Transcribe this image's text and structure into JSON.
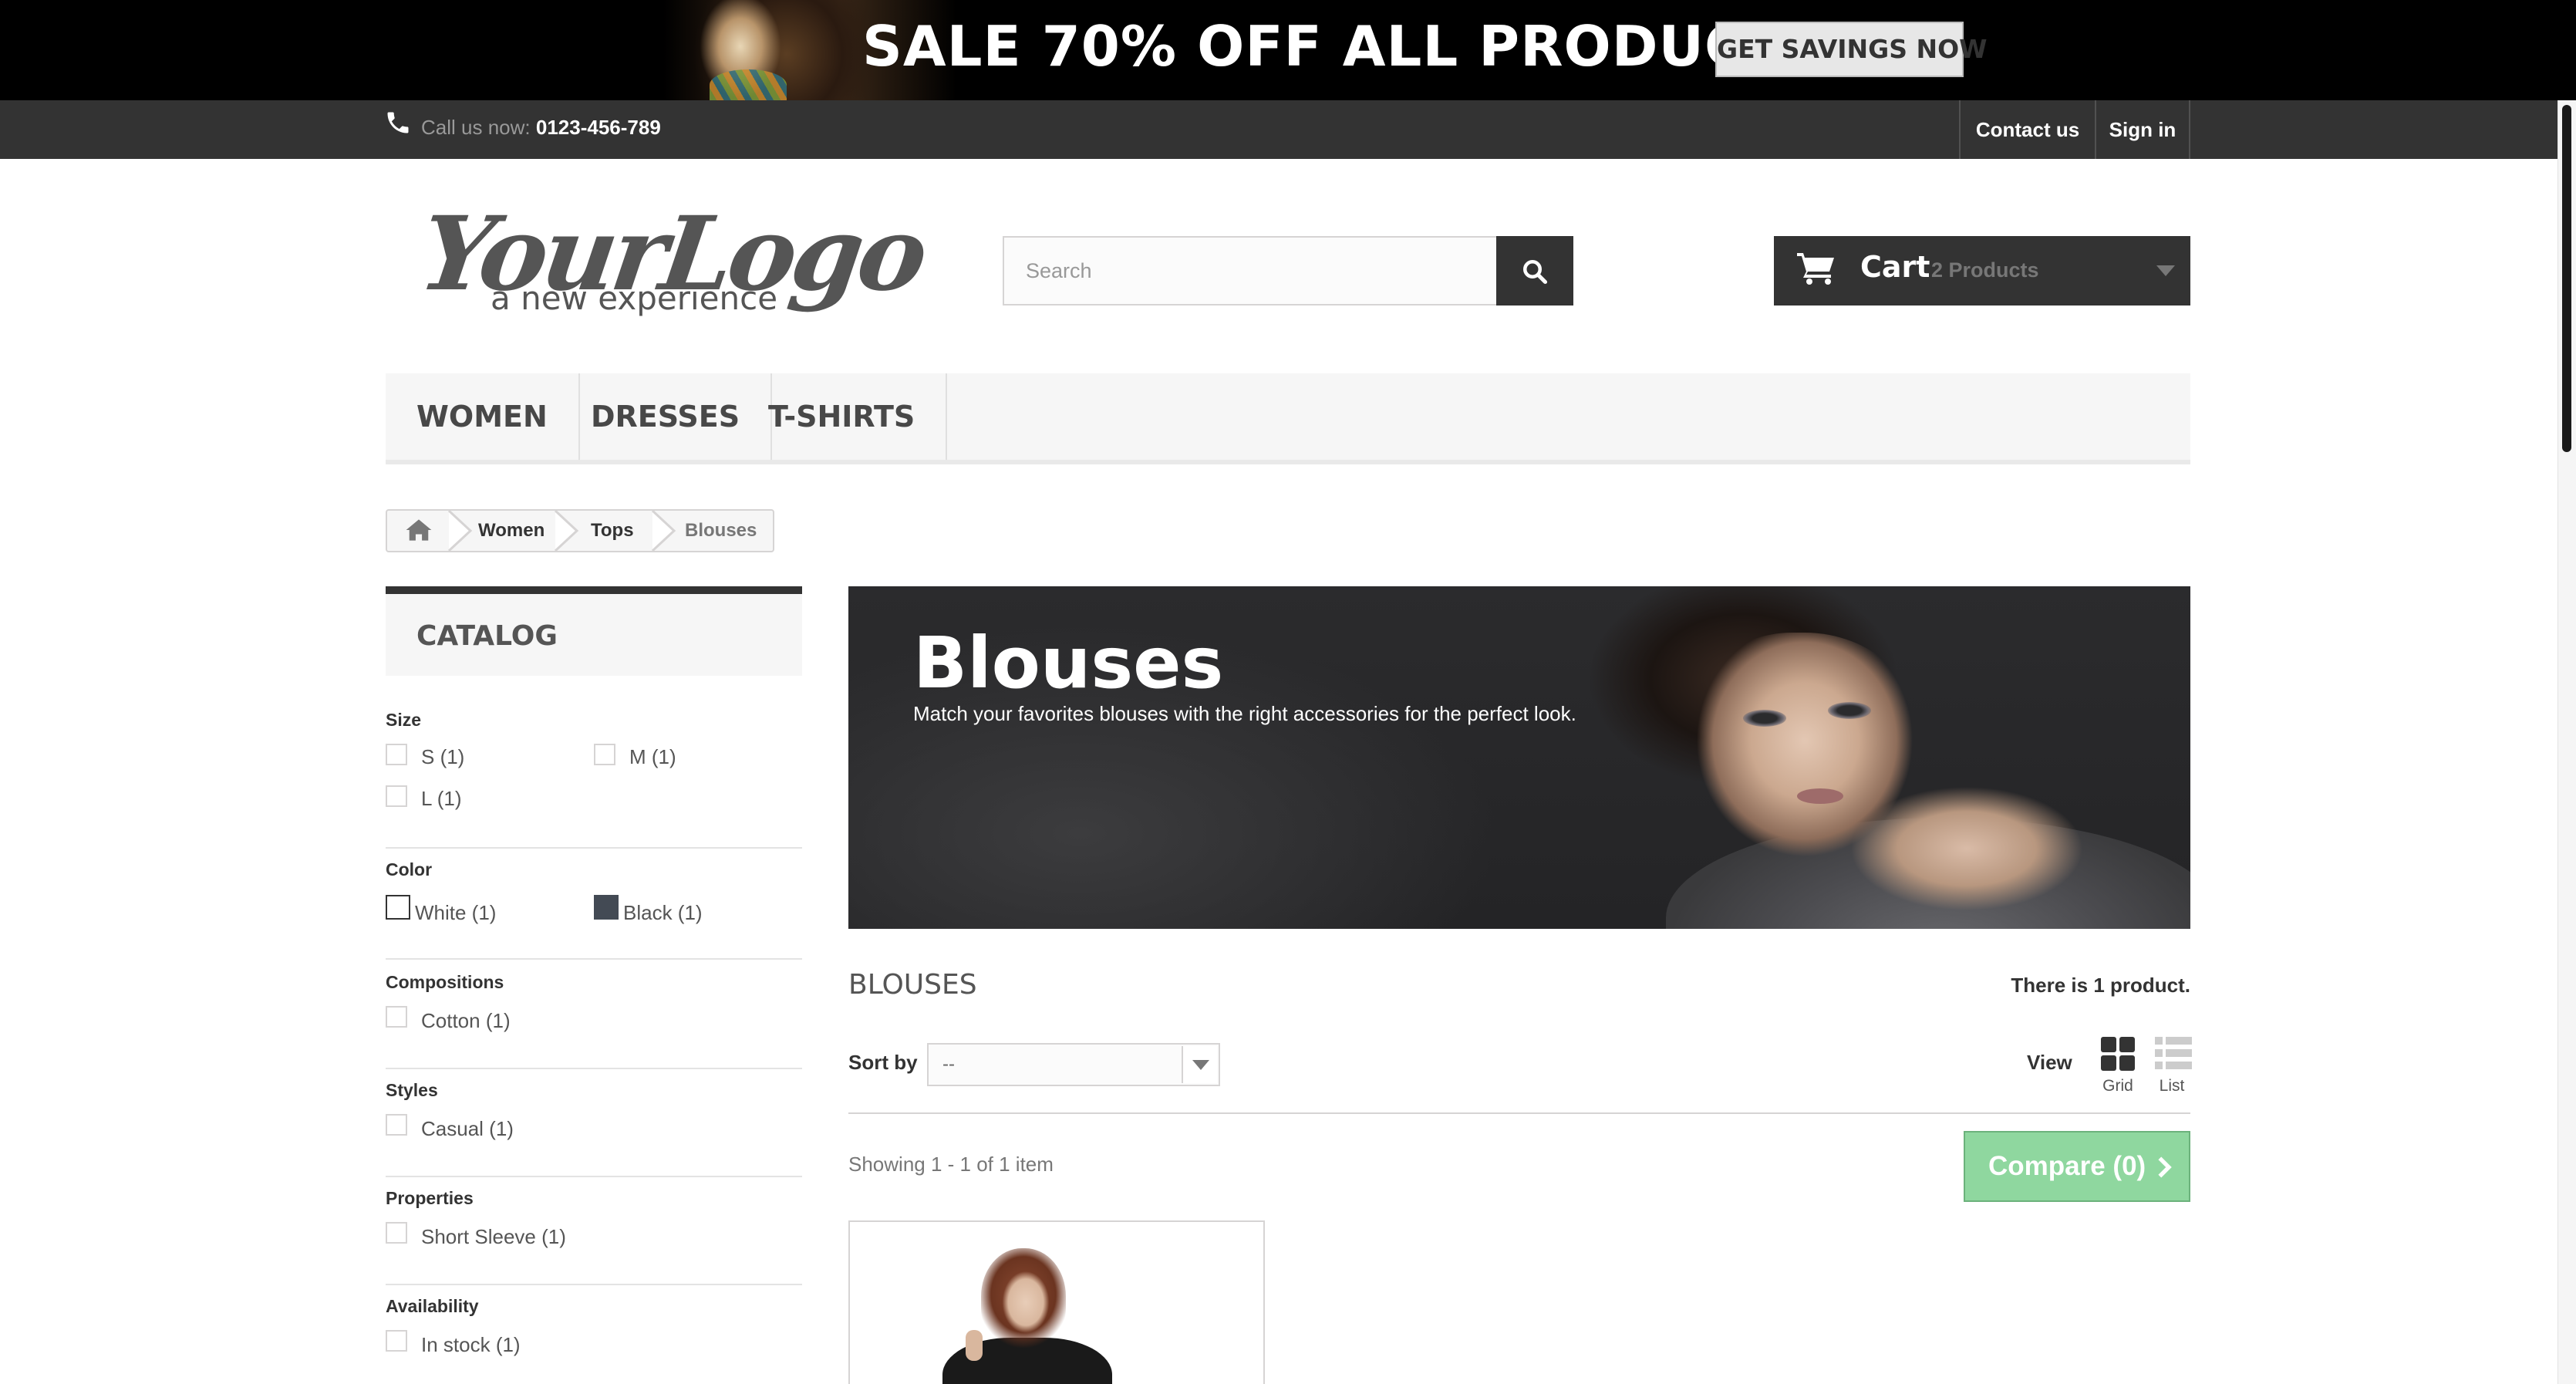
{
  "promo": {
    "headline": "SALE 70% OFF ALL PRODUCTS",
    "button": "GET SAVINGS NOW"
  },
  "topnav": {
    "call_label": "Call us now:",
    "phone": "0123-456-789",
    "contact": "Contact us",
    "signin": "Sign in"
  },
  "logo": {
    "main": "YourLogo",
    "tagline": "a new experience"
  },
  "search": {
    "placeholder": "Search"
  },
  "cart": {
    "label": "Cart",
    "count": "2 Products"
  },
  "menu": {
    "items": [
      "WOMEN",
      "DRESSES",
      "T-SHIRTS"
    ]
  },
  "breadcrumb": {
    "items": [
      "Women",
      "Tops",
      "Blouses"
    ]
  },
  "sidebar": {
    "title": "CATALOG",
    "filters": {
      "size": {
        "title": "Size",
        "options": [
          "S (1)",
          "M (1)",
          "L (1)"
        ]
      },
      "color": {
        "title": "Color",
        "options": [
          {
            "label": "White (1)",
            "color": "#ffffff"
          },
          {
            "label": "Black (1)",
            "color": "#434a54"
          }
        ]
      },
      "compositions": {
        "title": "Compositions",
        "options": [
          "Cotton (1)"
        ]
      },
      "styles": {
        "title": "Styles",
        "options": [
          "Casual (1)"
        ]
      },
      "properties": {
        "title": "Properties",
        "options": [
          "Short Sleeve (1)"
        ]
      },
      "availability": {
        "title": "Availability",
        "options": [
          "In stock (1)"
        ]
      }
    }
  },
  "category": {
    "banner_title": "Blouses",
    "banner_description": "Match your favorites blouses with the right accessories for the perfect look.",
    "heading": "BLOUSES",
    "product_count": "There is 1 product."
  },
  "toolbar": {
    "sort_label": "Sort by",
    "sort_value": "--",
    "view_label": "View",
    "view_grid": "Grid",
    "view_list": "List",
    "showing": "Showing 1 - 1 of 1 item",
    "compare": "Compare (0)"
  },
  "colors": {
    "dark": "#333333",
    "compare_green": "#8fd79f",
    "black_swatch": "#434a54"
  }
}
